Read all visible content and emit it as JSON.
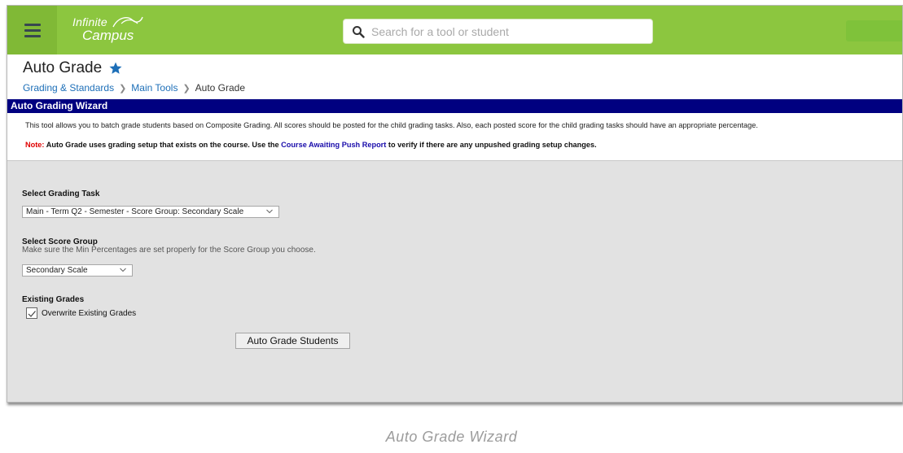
{
  "app": {
    "logo_text_1": "Infinite",
    "logo_text_2": "Campus",
    "brand_color": "#8cc63f"
  },
  "search": {
    "placeholder": "Search for a tool or student"
  },
  "page": {
    "title": "Auto Grade",
    "favorite_icon": "star-icon"
  },
  "breadcrumb": {
    "items": [
      "Grading & Standards",
      "Main Tools",
      "Auto Grade"
    ]
  },
  "wizard": {
    "title": "Auto Grading Wizard",
    "title_bar_color": "#000080",
    "intro": "This tool allows you to batch grade students based on Composite Grading. All scores should be posted for the child grading tasks. Also, each posted score for the child grading tasks should have an appropriate percentage.",
    "note_label": "Note:",
    "note_text_before": "Auto Grade uses grading setup that exists on the course. Use the",
    "note_link": "Course Awaiting Push Report",
    "note_text_after": "to verify if there are any unpushed grading setup changes."
  },
  "form": {
    "grading_task": {
      "label": "Select Grading Task",
      "selected": "Main - Term Q2 - Semester - Score Group: Secondary Scale"
    },
    "score_group": {
      "label": "Select Score Group",
      "hint": "Make sure the Min Percentages are set properly for the Score Group you choose.",
      "selected": "Secondary Scale"
    },
    "existing_grades": {
      "label": "Existing Grades",
      "checkbox_label": "Overwrite Existing Grades",
      "checked": true
    },
    "submit_label": "Auto Grade Students"
  },
  "caption": "Auto Grade Wizard"
}
